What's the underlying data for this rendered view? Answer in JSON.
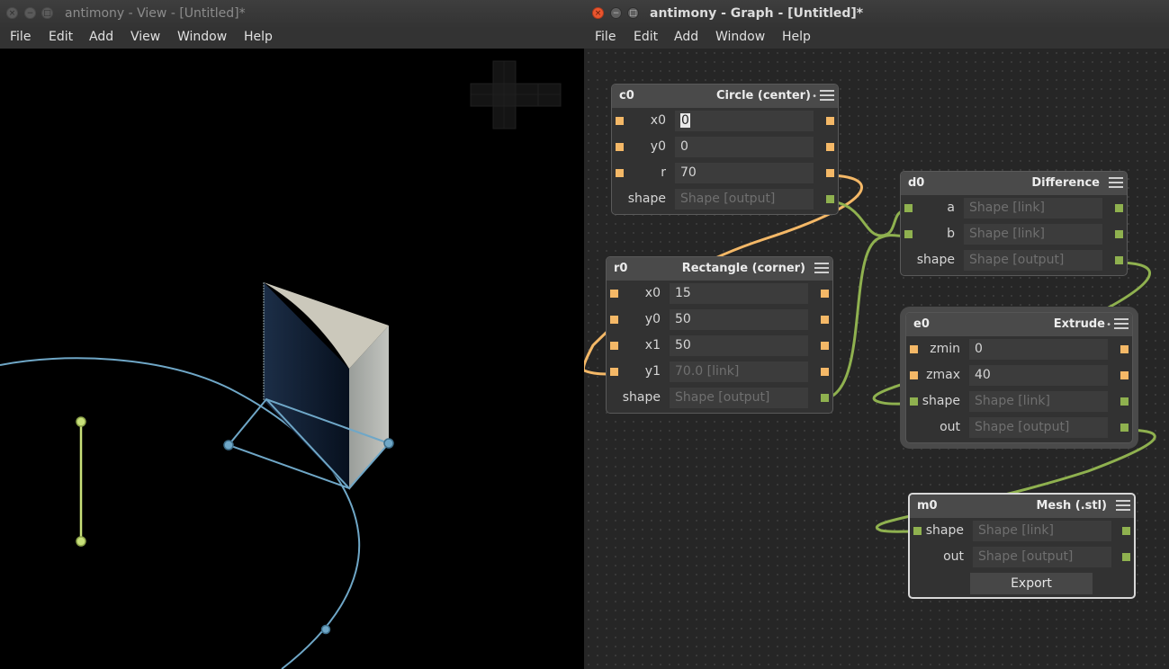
{
  "view_window": {
    "title": "antimony - View - [Untitled]*",
    "menu": [
      "File",
      "Edit",
      "Add",
      "View",
      "Window",
      "Help"
    ]
  },
  "graph_window": {
    "title": "antimony - Graph - [Untitled]*",
    "menu": [
      "File",
      "Edit",
      "Add",
      "Window",
      "Help"
    ]
  },
  "colors": {
    "number_port": "#f4b867",
    "shape_port": "#8fb14f",
    "view_wireframe": "#6fa7c7",
    "view_handle": "#c8e07a"
  },
  "nodes": {
    "circle": {
      "name": "c0",
      "type": "Circle (center)",
      "params": [
        {
          "label": "x0",
          "value": "0"
        },
        {
          "label": "y0",
          "value": "0"
        },
        {
          "label": "r",
          "value": "70"
        },
        {
          "label": "shape",
          "value": "Shape [output]"
        }
      ]
    },
    "rectangle": {
      "name": "r0",
      "type": "Rectangle (corner)",
      "params": [
        {
          "label": "x0",
          "value": "15"
        },
        {
          "label": "y0",
          "value": "50"
        },
        {
          "label": "x1",
          "value": "50"
        },
        {
          "label": "y1",
          "value": "70.0 [link]"
        },
        {
          "label": "shape",
          "value": "Shape [output]"
        }
      ]
    },
    "difference": {
      "name": "d0",
      "type": "Difference",
      "params": [
        {
          "label": "a",
          "value": "Shape [link]"
        },
        {
          "label": "b",
          "value": "Shape [link]"
        },
        {
          "label": "shape",
          "value": "Shape [output]"
        }
      ]
    },
    "extrude": {
      "name": "e0",
      "type": "Extrude",
      "params": [
        {
          "label": "zmin",
          "value": "0"
        },
        {
          "label": "zmax",
          "value": "40"
        },
        {
          "label": "shape",
          "value": "Shape [link]"
        },
        {
          "label": "out",
          "value": "Shape [output]"
        }
      ]
    },
    "mesh": {
      "name": "m0",
      "type": "Mesh (.stl)",
      "params": [
        {
          "label": "shape",
          "value": "Shape [link]"
        },
        {
          "label": "out",
          "value": "Shape [output]"
        }
      ],
      "export_label": "Export"
    }
  }
}
